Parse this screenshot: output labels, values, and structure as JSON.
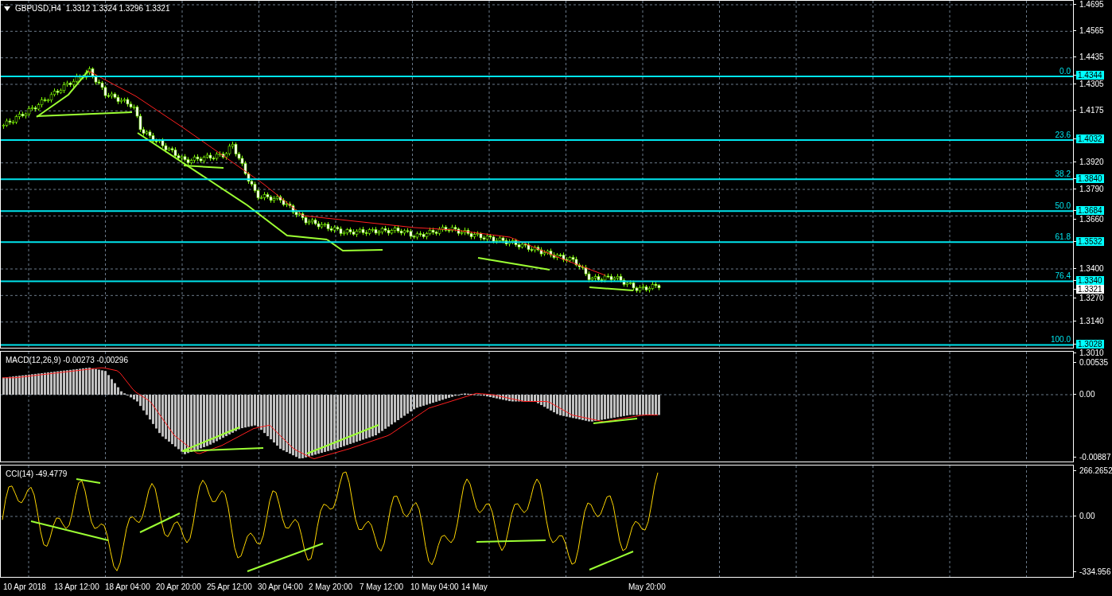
{
  "chart": {
    "symbol": "GBPUSD,H4",
    "ohlc": "1.3312 1.3324 1.3296 1.3321",
    "price_axis": [
      "1.4695",
      "1.4565",
      "1.4435",
      "1.4305",
      "1.4175",
      "1.3920",
      "1.3790",
      "1.3660",
      "1.3400",
      "1.3270",
      "1.3140",
      "1.3010"
    ],
    "current_price": "1.3321",
    "fib_levels": [
      {
        "ratio": "0.0",
        "price": "1.4344"
      },
      {
        "ratio": "23.6",
        "price": "1.4032"
      },
      {
        "ratio": "38.2",
        "price": "1.3840"
      },
      {
        "ratio": "50.0",
        "price": "1.3684"
      },
      {
        "ratio": "61.8",
        "price": "1.3532"
      },
      {
        "ratio": "76.4",
        "price": "1.3340"
      },
      {
        "ratio": "100.0",
        "price": "1.3028"
      }
    ]
  },
  "macd": {
    "title": "MACD(12,26,9) -0.00273 -0.00296",
    "axis": [
      "0.00535",
      "0.00",
      "-0.00887"
    ]
  },
  "cci": {
    "title": "CCI(14) -49.4779",
    "axis": [
      "266.2652",
      "0.00",
      "-334.956"
    ]
  },
  "time_axis": [
    "10 Apr 2018",
    "13 Apr 12:00",
    "18 Apr 04:00",
    "20 Apr 20:00",
    "25 Apr 12:00",
    "30 Apr 04:00",
    "2 May 20:00",
    "7 May 12:00",
    "10 May 04:00",
    "14 May",
    "May 20:00"
  ]
}
